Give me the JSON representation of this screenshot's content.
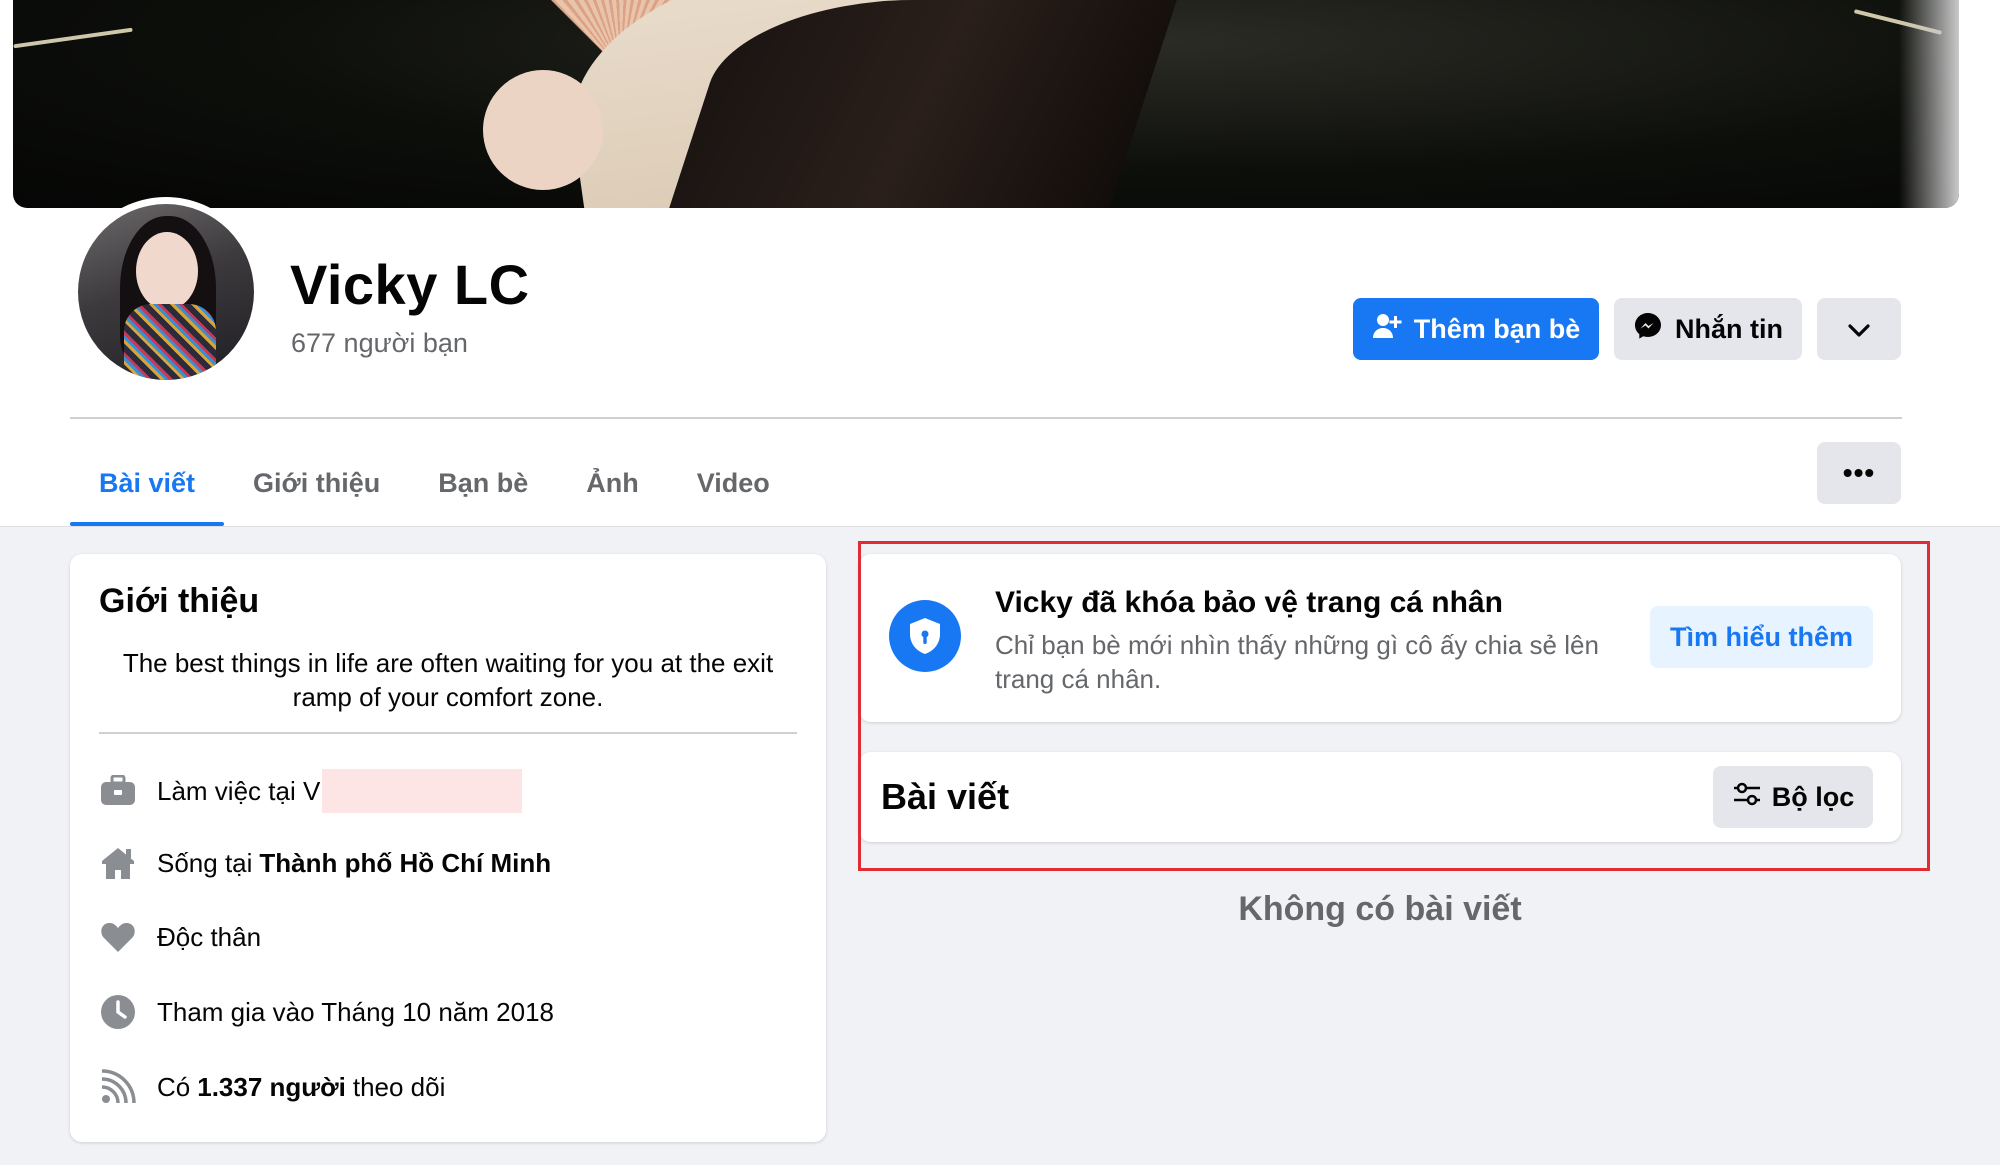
{
  "profile": {
    "name": "Vicky LC",
    "friends": "677 người bạn"
  },
  "actions": {
    "add_friend": "Thêm bạn bè",
    "message": "Nhắn tin"
  },
  "tabs": [
    {
      "label": "Bài viết",
      "active": true
    },
    {
      "label": "Giới thiệu",
      "active": false
    },
    {
      "label": "Bạn bè",
      "active": false
    },
    {
      "label": "Ảnh",
      "active": false
    },
    {
      "label": "Video",
      "active": false
    }
  ],
  "more_dots": "•••",
  "intro": {
    "title": "Giới thiệu",
    "bio": "The best things in life are often waiting for you at the exit ramp of your comfort zone.",
    "work_prefix": "Làm việc tại",
    "work_visible": "V",
    "lives_prefix": "Sống tại",
    "lives_city": "Thành phố Hồ Chí Minh",
    "relationship": "Độc thân",
    "joined": "Tham gia vào Tháng 10 năm 2018",
    "followers_prefix": "Có",
    "followers_count": "1.337 người",
    "followers_suffix": "theo dõi"
  },
  "lock_notice": {
    "title": "Vicky đã khóa bảo vệ trang cá nhân",
    "description": "Chỉ bạn bè mới nhìn thấy những gì cô ấy chia sẻ lên trang cá nhân.",
    "learn_more": "Tìm hiểu thêm"
  },
  "posts": {
    "title": "Bài viết",
    "filter": "Bộ lọc",
    "empty": "Không có bài viết"
  },
  "colors": {
    "accent": "#1877f2",
    "highlight_border": "#e02d34",
    "secondary_text": "#65676b"
  }
}
